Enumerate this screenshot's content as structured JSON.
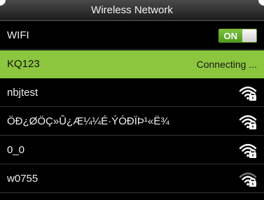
{
  "title": "Wireless Network",
  "wifi_row": {
    "label": "WIFI",
    "toggle_label": "ON"
  },
  "networks": [
    {
      "name": "KQ123",
      "status": "Connecting ...",
      "selected": true
    },
    {
      "name": "nbjtest",
      "icon": "wifi-locked-icon"
    },
    {
      "name": "ÖÐ¿ØÖÇ»Û¿Æ¼¼É·ÝÓÐÏÞ¹«Ë¾",
      "icon": "wifi-locked-icon"
    },
    {
      "name": "0_0",
      "icon": "wifi-locked-icon"
    },
    {
      "name": "w0755",
      "icon": "wifi-locked-icon"
    }
  ],
  "colors": {
    "selected": "#8cc63f",
    "toggle_on": "#5aaa22",
    "background": "#000000"
  }
}
